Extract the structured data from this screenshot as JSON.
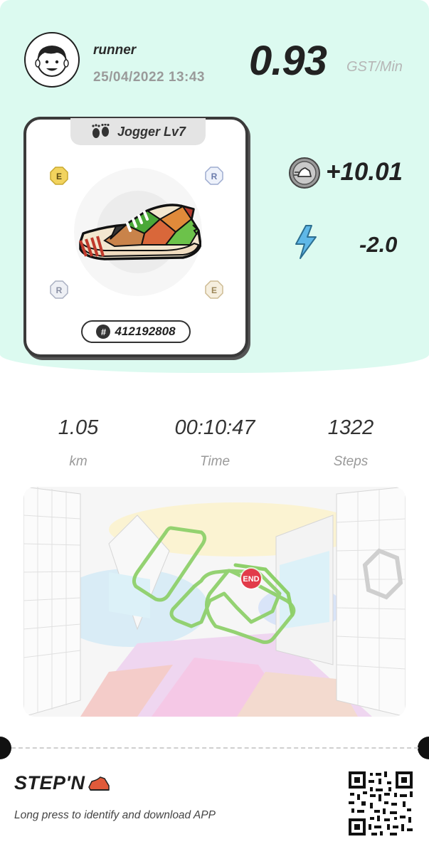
{
  "user": {
    "name": "runner",
    "datetime": "25/04/2022 13:43"
  },
  "earning_rate": {
    "value": "0.93",
    "unit": "GST/Min"
  },
  "sneaker": {
    "level_label": "Jogger Lv7",
    "id_symbol": "#",
    "id": "412192808",
    "socket_letters": [
      "E",
      "R",
      "R",
      "E"
    ]
  },
  "rewards": {
    "gst_change": "+10.01",
    "energy_change": "-2.0"
  },
  "stats": [
    {
      "value": "1.05",
      "label": "km"
    },
    {
      "value": "00:10:47",
      "label": "Time"
    },
    {
      "value": "1322",
      "label": "Steps"
    }
  ],
  "map": {
    "end_label": "END",
    "route_color": "#8ed06a"
  },
  "footer": {
    "logo_text": "STEP'N",
    "text": "Long press to identify and download APP"
  },
  "colors": {
    "top_bg": "#dcfaf0",
    "gem_yellow": "#f2d35e",
    "gem_blue": "#bcc8e6",
    "gem_beige": "#e8dcc3",
    "energy_blue": "#5fb8e8",
    "end_red": "#e23b4a"
  },
  "icons": {
    "avatar": "avatar-face",
    "level": "footprints-icon",
    "gst": "gst-coin-icon",
    "energy": "lightning-icon",
    "qr": "qr-code"
  }
}
